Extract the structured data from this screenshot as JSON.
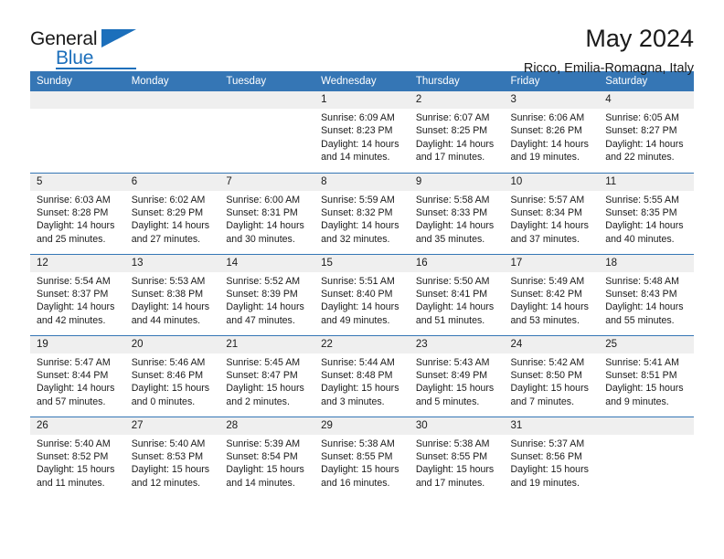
{
  "brand": {
    "name_part1": "General",
    "name_part2": "Blue",
    "logo_icon": "blue-triangle-icon"
  },
  "header": {
    "title": "May 2024",
    "location": "Ricco, Emilia-Romagna, Italy"
  },
  "calendar": {
    "weekday_headers": [
      "Sunday",
      "Monday",
      "Tuesday",
      "Wednesday",
      "Thursday",
      "Friday",
      "Saturday"
    ],
    "accent_color": "#3576b5",
    "daynum_band_color": "#efefef",
    "weeks": [
      [
        {
          "day": "",
          "empty": true
        },
        {
          "day": "",
          "empty": true
        },
        {
          "day": "",
          "empty": true
        },
        {
          "day": "1",
          "sunrise": "Sunrise: 6:09 AM",
          "sunset": "Sunset: 8:23 PM",
          "daylight_line1": "Daylight: 14 hours",
          "daylight_line2": "and 14 minutes."
        },
        {
          "day": "2",
          "sunrise": "Sunrise: 6:07 AM",
          "sunset": "Sunset: 8:25 PM",
          "daylight_line1": "Daylight: 14 hours",
          "daylight_line2": "and 17 minutes."
        },
        {
          "day": "3",
          "sunrise": "Sunrise: 6:06 AM",
          "sunset": "Sunset: 8:26 PM",
          "daylight_line1": "Daylight: 14 hours",
          "daylight_line2": "and 19 minutes."
        },
        {
          "day": "4",
          "sunrise": "Sunrise: 6:05 AM",
          "sunset": "Sunset: 8:27 PM",
          "daylight_line1": "Daylight: 14 hours",
          "daylight_line2": "and 22 minutes."
        }
      ],
      [
        {
          "day": "5",
          "sunrise": "Sunrise: 6:03 AM",
          "sunset": "Sunset: 8:28 PM",
          "daylight_line1": "Daylight: 14 hours",
          "daylight_line2": "and 25 minutes."
        },
        {
          "day": "6",
          "sunrise": "Sunrise: 6:02 AM",
          "sunset": "Sunset: 8:29 PM",
          "daylight_line1": "Daylight: 14 hours",
          "daylight_line2": "and 27 minutes."
        },
        {
          "day": "7",
          "sunrise": "Sunrise: 6:00 AM",
          "sunset": "Sunset: 8:31 PM",
          "daylight_line1": "Daylight: 14 hours",
          "daylight_line2": "and 30 minutes."
        },
        {
          "day": "8",
          "sunrise": "Sunrise: 5:59 AM",
          "sunset": "Sunset: 8:32 PM",
          "daylight_line1": "Daylight: 14 hours",
          "daylight_line2": "and 32 minutes."
        },
        {
          "day": "9",
          "sunrise": "Sunrise: 5:58 AM",
          "sunset": "Sunset: 8:33 PM",
          "daylight_line1": "Daylight: 14 hours",
          "daylight_line2": "and 35 minutes."
        },
        {
          "day": "10",
          "sunrise": "Sunrise: 5:57 AM",
          "sunset": "Sunset: 8:34 PM",
          "daylight_line1": "Daylight: 14 hours",
          "daylight_line2": "and 37 minutes."
        },
        {
          "day": "11",
          "sunrise": "Sunrise: 5:55 AM",
          "sunset": "Sunset: 8:35 PM",
          "daylight_line1": "Daylight: 14 hours",
          "daylight_line2": "and 40 minutes."
        }
      ],
      [
        {
          "day": "12",
          "sunrise": "Sunrise: 5:54 AM",
          "sunset": "Sunset: 8:37 PM",
          "daylight_line1": "Daylight: 14 hours",
          "daylight_line2": "and 42 minutes."
        },
        {
          "day": "13",
          "sunrise": "Sunrise: 5:53 AM",
          "sunset": "Sunset: 8:38 PM",
          "daylight_line1": "Daylight: 14 hours",
          "daylight_line2": "and 44 minutes."
        },
        {
          "day": "14",
          "sunrise": "Sunrise: 5:52 AM",
          "sunset": "Sunset: 8:39 PM",
          "daylight_line1": "Daylight: 14 hours",
          "daylight_line2": "and 47 minutes."
        },
        {
          "day": "15",
          "sunrise": "Sunrise: 5:51 AM",
          "sunset": "Sunset: 8:40 PM",
          "daylight_line1": "Daylight: 14 hours",
          "daylight_line2": "and 49 minutes."
        },
        {
          "day": "16",
          "sunrise": "Sunrise: 5:50 AM",
          "sunset": "Sunset: 8:41 PM",
          "daylight_line1": "Daylight: 14 hours",
          "daylight_line2": "and 51 minutes."
        },
        {
          "day": "17",
          "sunrise": "Sunrise: 5:49 AM",
          "sunset": "Sunset: 8:42 PM",
          "daylight_line1": "Daylight: 14 hours",
          "daylight_line2": "and 53 minutes."
        },
        {
          "day": "18",
          "sunrise": "Sunrise: 5:48 AM",
          "sunset": "Sunset: 8:43 PM",
          "daylight_line1": "Daylight: 14 hours",
          "daylight_line2": "and 55 minutes."
        }
      ],
      [
        {
          "day": "19",
          "sunrise": "Sunrise: 5:47 AM",
          "sunset": "Sunset: 8:44 PM",
          "daylight_line1": "Daylight: 14 hours",
          "daylight_line2": "and 57 minutes."
        },
        {
          "day": "20",
          "sunrise": "Sunrise: 5:46 AM",
          "sunset": "Sunset: 8:46 PM",
          "daylight_line1": "Daylight: 15 hours",
          "daylight_line2": "and 0 minutes."
        },
        {
          "day": "21",
          "sunrise": "Sunrise: 5:45 AM",
          "sunset": "Sunset: 8:47 PM",
          "daylight_line1": "Daylight: 15 hours",
          "daylight_line2": "and 2 minutes."
        },
        {
          "day": "22",
          "sunrise": "Sunrise: 5:44 AM",
          "sunset": "Sunset: 8:48 PM",
          "daylight_line1": "Daylight: 15 hours",
          "daylight_line2": "and 3 minutes."
        },
        {
          "day": "23",
          "sunrise": "Sunrise: 5:43 AM",
          "sunset": "Sunset: 8:49 PM",
          "daylight_line1": "Daylight: 15 hours",
          "daylight_line2": "and 5 minutes."
        },
        {
          "day": "24",
          "sunrise": "Sunrise: 5:42 AM",
          "sunset": "Sunset: 8:50 PM",
          "daylight_line1": "Daylight: 15 hours",
          "daylight_line2": "and 7 minutes."
        },
        {
          "day": "25",
          "sunrise": "Sunrise: 5:41 AM",
          "sunset": "Sunset: 8:51 PM",
          "daylight_line1": "Daylight: 15 hours",
          "daylight_line2": "and 9 minutes."
        }
      ],
      [
        {
          "day": "26",
          "sunrise": "Sunrise: 5:40 AM",
          "sunset": "Sunset: 8:52 PM",
          "daylight_line1": "Daylight: 15 hours",
          "daylight_line2": "and 11 minutes."
        },
        {
          "day": "27",
          "sunrise": "Sunrise: 5:40 AM",
          "sunset": "Sunset: 8:53 PM",
          "daylight_line1": "Daylight: 15 hours",
          "daylight_line2": "and 12 minutes."
        },
        {
          "day": "28",
          "sunrise": "Sunrise: 5:39 AM",
          "sunset": "Sunset: 8:54 PM",
          "daylight_line1": "Daylight: 15 hours",
          "daylight_line2": "and 14 minutes."
        },
        {
          "day": "29",
          "sunrise": "Sunrise: 5:38 AM",
          "sunset": "Sunset: 8:55 PM",
          "daylight_line1": "Daylight: 15 hours",
          "daylight_line2": "and 16 minutes."
        },
        {
          "day": "30",
          "sunrise": "Sunrise: 5:38 AM",
          "sunset": "Sunset: 8:55 PM",
          "daylight_line1": "Daylight: 15 hours",
          "daylight_line2": "and 17 minutes."
        },
        {
          "day": "31",
          "sunrise": "Sunrise: 5:37 AM",
          "sunset": "Sunset: 8:56 PM",
          "daylight_line1": "Daylight: 15 hours",
          "daylight_line2": "and 19 minutes."
        },
        {
          "day": "",
          "empty": true
        }
      ]
    ]
  }
}
